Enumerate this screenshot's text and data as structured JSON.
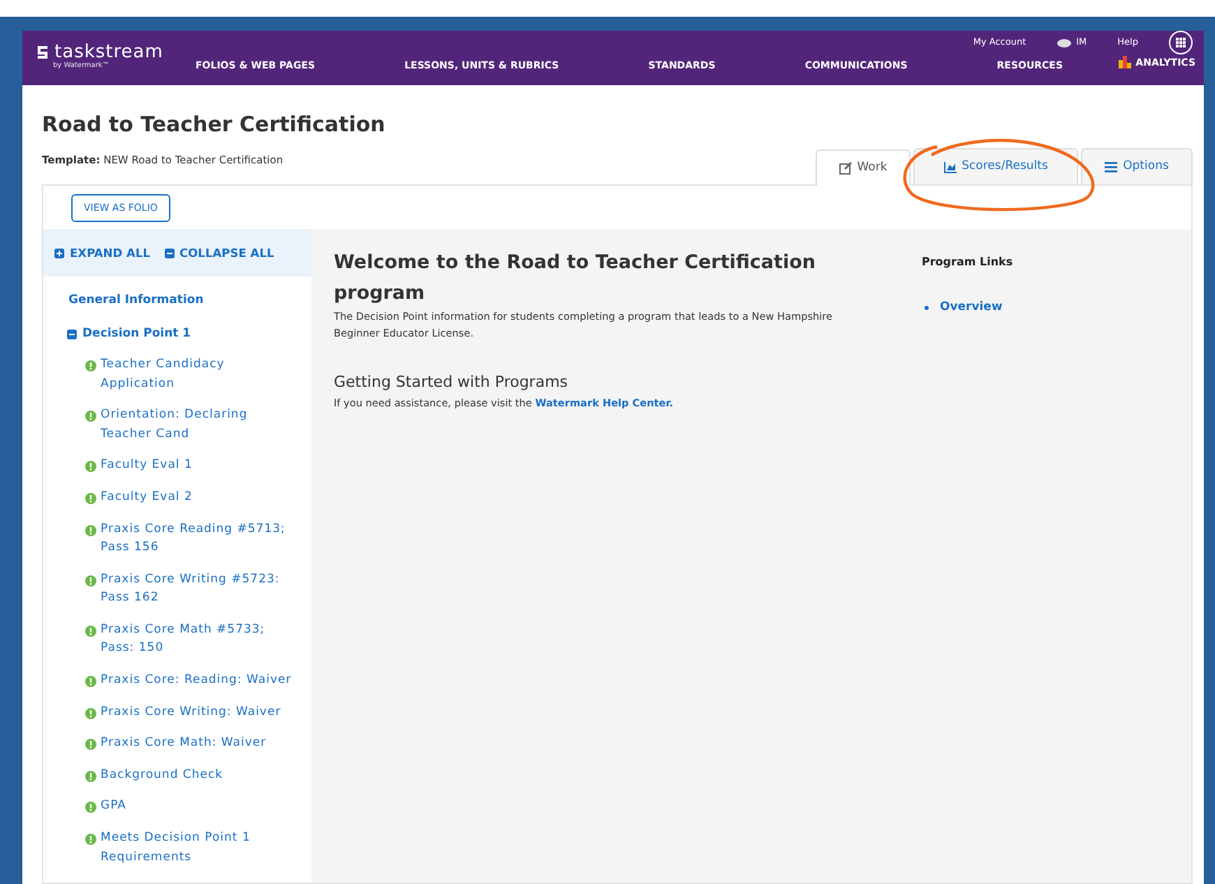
{
  "header": {
    "logo": "taskstream",
    "logo_sub": "by Watermark™",
    "utility_links": [
      "My Account",
      "IM",
      "Help"
    ],
    "nav": [
      "FOLIOS & WEB PAGES",
      "LESSONS, UNITS & RUBRICS",
      "STANDARDS",
      "COMMUNICATIONS",
      "RESOURCES"
    ],
    "analytics": "ANALYTICS"
  },
  "page": {
    "title": "Road to Teacher Certification",
    "template": "**Template:** NEW Road to Teacher Certification"
  },
  "tabs": [
    {
      "label": "Work",
      "selected": true
    },
    {
      "label": "Scores/Results",
      "selected": false
    },
    {
      "label": "Options",
      "selected": false
    }
  ],
  "view_as_folio": "VIEW AS FOLIO",
  "tree": {
    "expand_all": "EXPAND ALL",
    "collapse_all": "COLLAPSE ALL",
    "items": [
      {
        "label": "General Information",
        "kind": "section"
      },
      {
        "label": "Decision Point 1",
        "kind": "folder",
        "expanded": true,
        "children": [
          {
            "label": "Teacher Candidacy Application"
          },
          {
            "label": "Orientation: Declaring Teacher Cand"
          },
          {
            "label": "Faculty Eval 1"
          },
          {
            "label": "Faculty Eval 2"
          },
          {
            "label": "Praxis Core Reading #5713; Pass 156"
          },
          {
            "label": "Praxis Core Writing #5723: Pass 162"
          },
          {
            "label": "Praxis Core Math #5733; Pass: 150"
          },
          {
            "label": "Praxis Core: Reading: Waiver"
          },
          {
            "label": "Praxis Core Writing: Waiver"
          },
          {
            "label": "Praxis Core Math: Waiver"
          },
          {
            "label": "Background Check"
          },
          {
            "label": "GPA"
          },
          {
            "label": "Meets Decision Point 1 Requirements"
          }
        ]
      }
    ]
  },
  "content": {
    "heading": "Welcome to the Road to Teacher Certification program",
    "description": "The Decision Point information for students completing a program that leads to a New Hampshire Beginner Educator License.",
    "subheading": "Getting Started with Programs",
    "help_text": "If you need assistance, please visit the",
    "help_link": "Watermark Help Center."
  },
  "program_links": {
    "title": "Program Links",
    "links": [
      "Overview"
    ]
  }
}
